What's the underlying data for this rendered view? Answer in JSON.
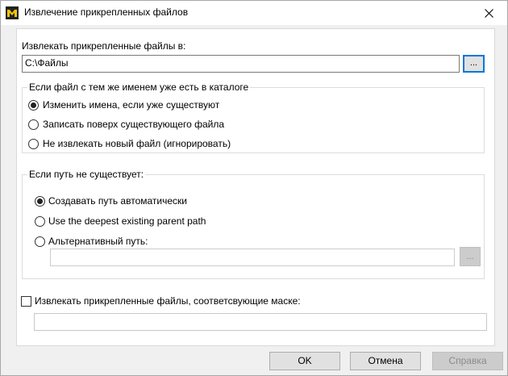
{
  "window": {
    "title": "Извлечение прикрепленных файлов"
  },
  "extract_to": {
    "label": "Извлекать прикрепленные файлы в:",
    "value": "C:\\Файлы",
    "browse_label": "..."
  },
  "existing_file": {
    "title": "Если файл с тем же именем уже есть в каталоге",
    "options": [
      {
        "label": "Изменить имена, если уже существуют",
        "checked": true
      },
      {
        "label": "Записать поверх существующего файла",
        "checked": false
      },
      {
        "label": "Не извлекать новый файл (игнорировать)",
        "checked": false
      }
    ]
  },
  "missing_path": {
    "title": "Если путь не существует:",
    "options": [
      {
        "label": "Создавать путь автоматически",
        "checked": true
      },
      {
        "label": "Use the deepest existing parent path",
        "checked": false
      },
      {
        "label": "Альтернативный путь:",
        "checked": false
      }
    ],
    "alt_path_value": "",
    "browse_label": "..."
  },
  "mask": {
    "label": "Извлекать прикрепленные файлы, соответсвующие маске:",
    "checked": false,
    "value": ""
  },
  "buttons": {
    "ok": "OK",
    "cancel": "Отмена",
    "help": "Справка"
  }
}
